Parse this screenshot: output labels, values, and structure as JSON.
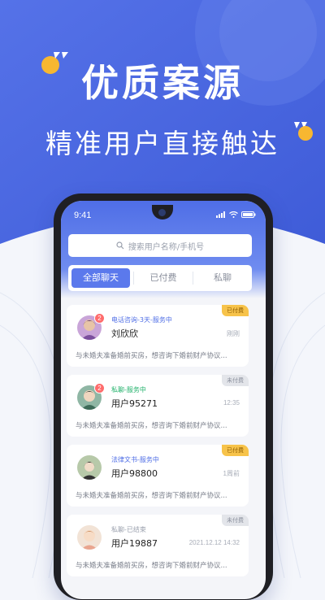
{
  "promo": {
    "headline": "优质案源",
    "subline": "精准用户直接触达"
  },
  "phone": {
    "status_time": "9:41",
    "search_placeholder": "搜索用户名称/手机号",
    "tabs": [
      {
        "label": "全部聊天",
        "active": true
      },
      {
        "label": "已付费",
        "active": false
      },
      {
        "label": "私聊",
        "active": false
      }
    ],
    "chats": [
      {
        "service": "电话咨询-3天-服务中",
        "service_color": "blue",
        "name": "刘欣欣",
        "time": "刚刚",
        "badge": "已付费",
        "badge_type": "paid",
        "unread": "2",
        "snippet": "与未婚夫准备婚前买房，想咨询下婚前财产协议..."
      },
      {
        "service": "私聊-服务中",
        "service_color": "green",
        "name": "用户95271",
        "time": "12:35",
        "badge": "未付费",
        "badge_type": "unpaid",
        "unread": "2",
        "snippet": "与未婚夫准备婚前买房，想咨询下婚前财产协议..."
      },
      {
        "service": "法律文书-服务中",
        "service_color": "blue",
        "name": "用户98800",
        "time": "1周前",
        "badge": "已付费",
        "badge_type": "paid",
        "unread": "",
        "snippet": "与未婚夫准备婚前买房，想咨询下婚前财产协议..."
      },
      {
        "service": "私聊-已结束",
        "service_color": "gray",
        "name": "用户19887",
        "time": "2021.12.12 14:32",
        "badge": "未付费",
        "badge_type": "unpaid",
        "unread": "",
        "snippet": "与未婚夫准备婚前买房，想咨询下婚前财产协议..."
      }
    ]
  },
  "colors": {
    "brand_blue": "#4f6ee6",
    "tab_active": "#5b79ec",
    "paid_badge": "#f7c34a",
    "quote_yellow": "#f7b731"
  },
  "icons": [
    "quote-open-icon",
    "quote-close-icon",
    "search-icon",
    "signal-icon",
    "wifi-icon",
    "battery-icon"
  ]
}
